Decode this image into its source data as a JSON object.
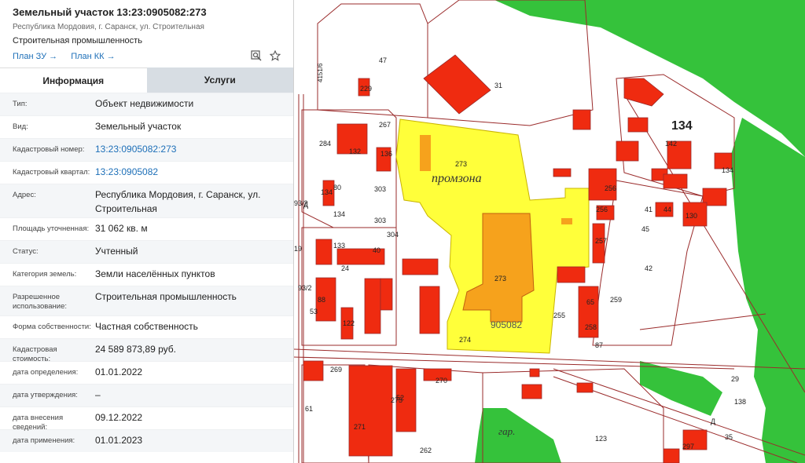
{
  "panel": {
    "title": "Земельный участок 13:23:0905082:273",
    "address_short": "Республика Мордовия, г. Саранск, ул. Строительная",
    "purpose": "Строительная промышленность",
    "plan_zu": "План ЗУ →",
    "plan_kk": "План КК →",
    "icons": {
      "search": "search-icon",
      "favorite": "star-icon"
    },
    "tabs": [
      {
        "label": "Информация",
        "active": true
      },
      {
        "label": "Услуги",
        "active": false
      }
    ],
    "rows": [
      {
        "label": "Тип:",
        "value": "Объект недвижимости",
        "link": false
      },
      {
        "label": "Вид:",
        "value": "Земельный участок",
        "link": false
      },
      {
        "label": "Кадастровый номер:",
        "value": "13:23:0905082:273",
        "link": true
      },
      {
        "label": "Кадастровый квартал:",
        "value": "13:23:0905082",
        "link": true
      },
      {
        "label": "Адрес:",
        "value": "Республика Мордовия, г. Саранск, ул. Строительная",
        "link": false
      },
      {
        "label": "Площадь уточненная:",
        "value": "31 062 кв. м",
        "link": false
      },
      {
        "label": "Статус:",
        "value": "Учтенный",
        "link": false
      },
      {
        "label": "Категория земель:",
        "value": "Земли населённых пунктов",
        "link": false
      },
      {
        "label": "Разрешенное использование:",
        "value": "Строительная промышленность",
        "link": false
      },
      {
        "label": "Форма собственности:",
        "value": "Частная собственность",
        "link": false
      },
      {
        "label": "Кадастровая стоимость:",
        "value": "24 589 873,89 руб.",
        "link": false
      },
      {
        "label": "дата определения:",
        "value": "01.01.2022",
        "link": false
      },
      {
        "label": "дата утверждения:",
        "value": "–",
        "link": false
      },
      {
        "label": "дата внесения сведений:",
        "value": "09.12.2022",
        "link": false
      },
      {
        "label": "дата применения:",
        "value": "01.01.2023",
        "link": false
      }
    ]
  },
  "map": {
    "colors": {
      "green": "#35c23b",
      "building": "#ef2b10",
      "yellow": "#ffff3a",
      "orange": "#f6a21c",
      "line": "#9a2b2b"
    },
    "zone_label": "промзона",
    "garage_label": "гар.",
    "block_label": "905082",
    "big_number": "134",
    "street_label": "4151/6",
    "labels": [
      "47",
      "31",
      "229",
      "267",
      "284",
      "132",
      "136",
      "273",
      "303",
      "134",
      "80",
      "134",
      "303",
      "304",
      "40",
      "133",
      "24",
      "88",
      "53",
      "122",
      "273",
      "274",
      "255",
      "256",
      "256",
      "41",
      "44",
      "45",
      "42",
      "257",
      "259",
      "65",
      "258",
      "87",
      "142",
      "134",
      "130",
      "269",
      "61",
      "271",
      "275",
      "52",
      "270",
      "262",
      "123",
      "297",
      "29",
      "138",
      "35",
      "19",
      "93/2",
      "93/2",
      "Д",
      "Д",
      "А"
    ]
  }
}
